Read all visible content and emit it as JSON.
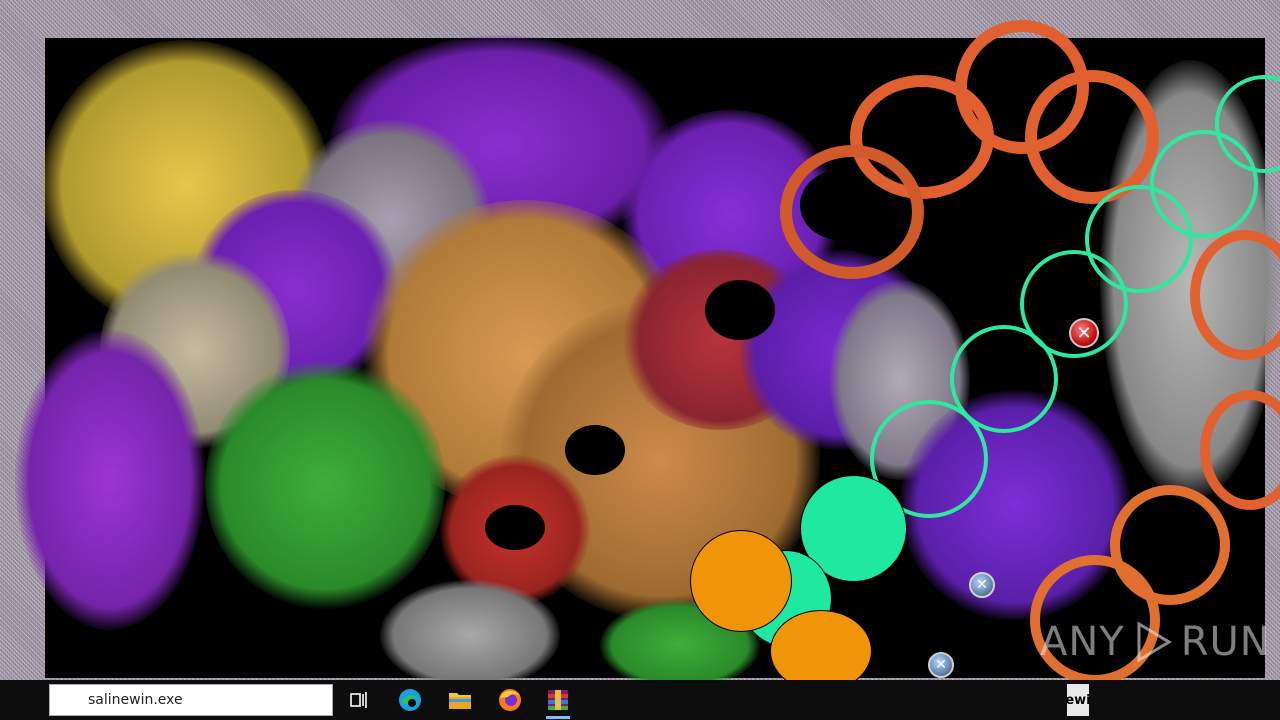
{
  "taskbar": {
    "search_text": "salinewin.exe",
    "icons": [
      "task-view-icon",
      "edge-icon",
      "file-explorer-icon",
      "firefox-icon",
      "winrar-icon"
    ],
    "right_fragment": "ewi"
  },
  "watermark": {
    "text_left": "ANY",
    "text_right": "RUN"
  },
  "dialogs": {
    "error_symbol": "✕",
    "small_x_symbol": "✕"
  }
}
